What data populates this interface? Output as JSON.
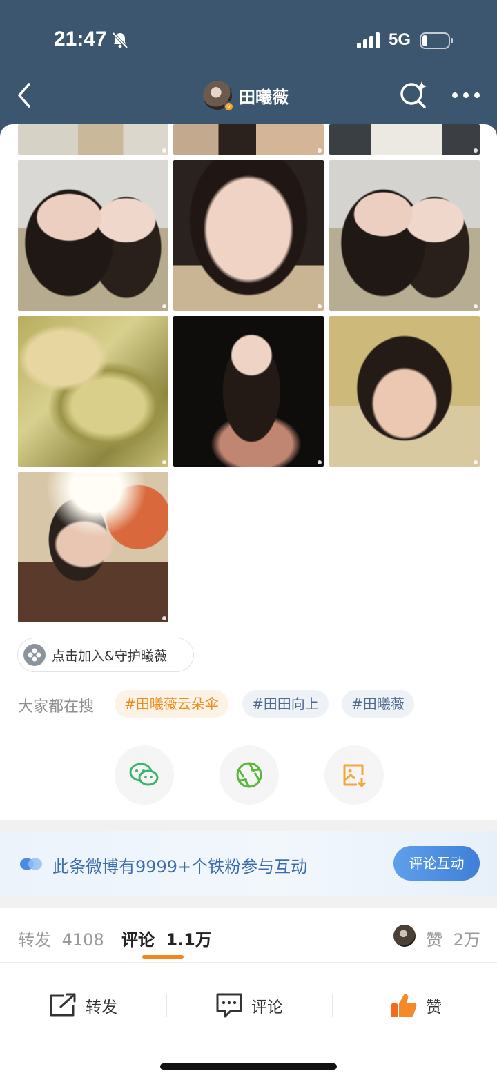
{
  "status_bar": {
    "time": "21:47",
    "network": "5G"
  },
  "header": {
    "title": "田曦薇"
  },
  "photos": [
    {
      "id": "photo-top-1"
    },
    {
      "id": "photo-top-2"
    },
    {
      "id": "photo-top-3"
    },
    {
      "id": "photo-1"
    },
    {
      "id": "photo-2"
    },
    {
      "id": "photo-3"
    },
    {
      "id": "photo-4"
    },
    {
      "id": "photo-5"
    },
    {
      "id": "photo-6"
    },
    {
      "id": "photo-7"
    }
  ],
  "post": {
    "join_label": "点击加入&守护曦薇",
    "hot_search_label": "大家都在搜",
    "hot_tags": [
      "#田曦薇云朵伞",
      "#田田向上",
      "#田曦薇"
    ]
  },
  "share_icons": [
    "wechat-icon",
    "moments-icon",
    "save-image-icon"
  ],
  "banner": {
    "text": "此条微博有9999+个铁粉参与互动",
    "button": "评论互动"
  },
  "tabs": {
    "repost_label": "转发",
    "repost_count": "4108",
    "comment_label": "评论",
    "comment_count": "1.1万",
    "like_label": "赞",
    "like_count": "2万"
  },
  "actions": {
    "repost": "转发",
    "comment": "评论",
    "like": "赞"
  },
  "colors": {
    "header_bg": "#3d5670",
    "accent_orange": "#f5861f",
    "banner_button": "#4a8ae0",
    "tag_orange": "#f08c1e",
    "tag_blue": "#4e6a8f"
  }
}
